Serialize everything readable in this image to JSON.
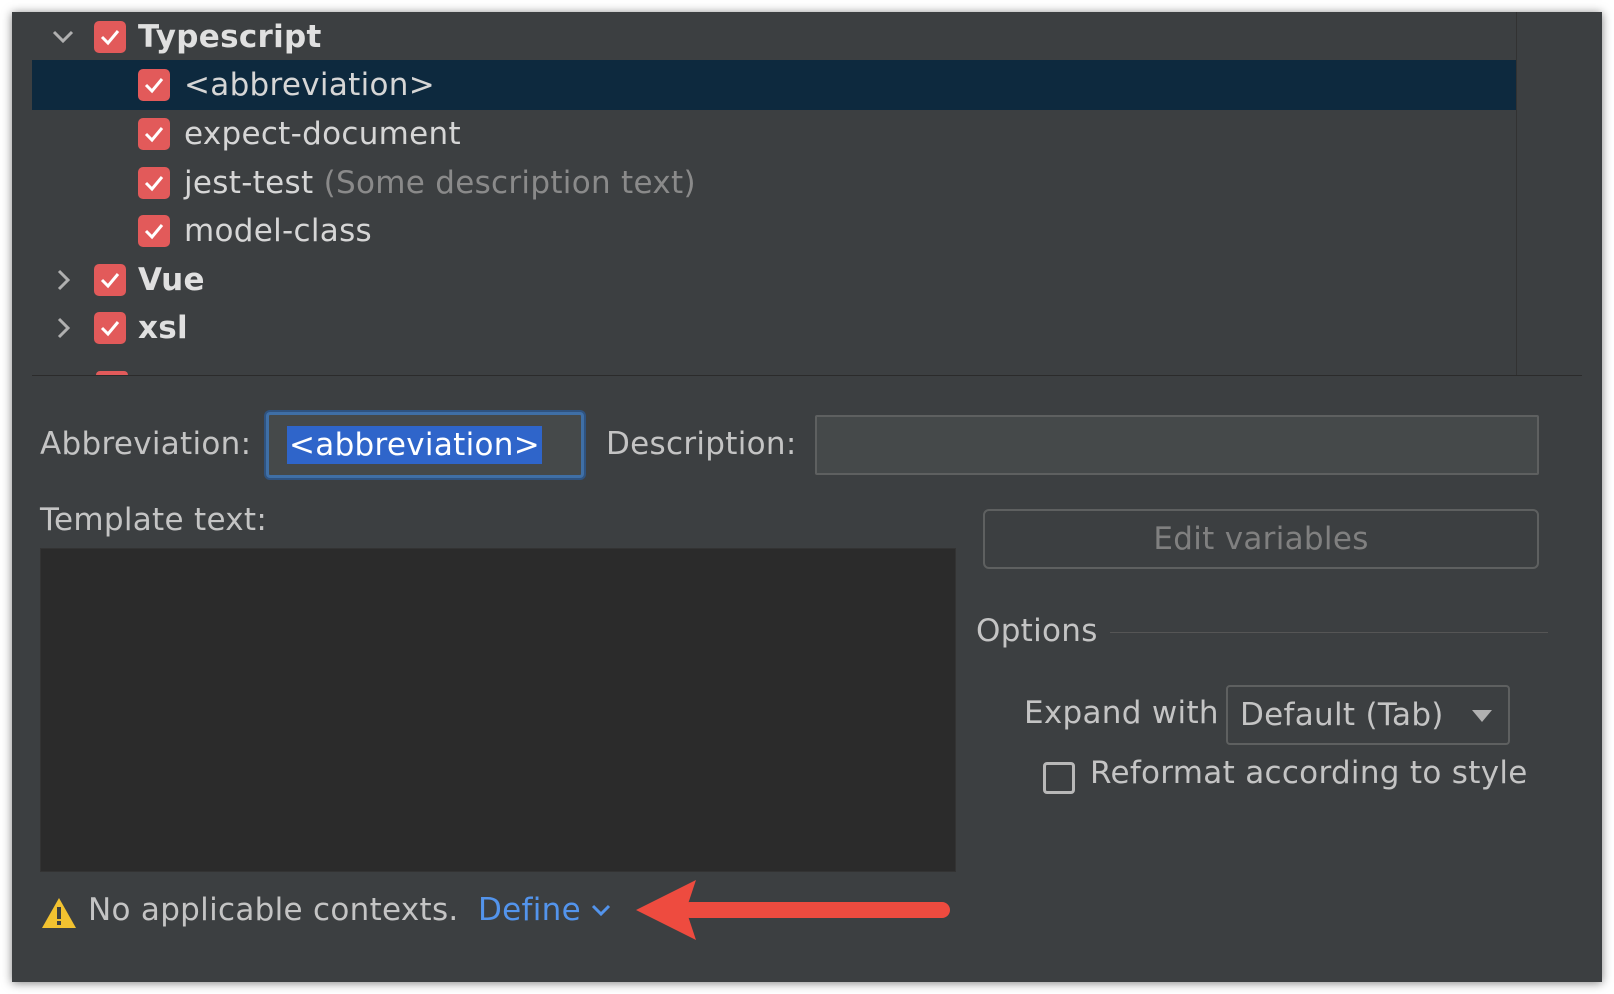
{
  "tree": {
    "groups": [
      {
        "label": "Typescript",
        "expanded": true,
        "checked": true
      },
      {
        "label": "Vue",
        "expanded": false,
        "checked": true
      },
      {
        "label": "xsl",
        "expanded": false,
        "checked": true
      }
    ],
    "items": [
      {
        "label": "<abbreviation>",
        "description": "",
        "checked": true,
        "selected": true
      },
      {
        "label": "expect-document",
        "description": "",
        "checked": true,
        "selected": false
      },
      {
        "label": "jest-test",
        "description": "(Some description text)",
        "checked": true,
        "selected": false
      },
      {
        "label": "model-class",
        "description": "",
        "checked": true,
        "selected": false
      }
    ]
  },
  "form": {
    "abbreviation_label": "Abbreviation:",
    "abbreviation_value": "<abbreviation>",
    "description_label": "Description:",
    "description_value": "",
    "template_label": "Template text:",
    "template_value": "",
    "edit_variables_label": "Edit variables",
    "options_label": "Options",
    "expand_with_label": "Expand with",
    "expand_with_value": "Default (Tab)",
    "reformat_label": "Reformat according to style",
    "reformat_checked": false
  },
  "footer": {
    "warning_text": "No applicable contexts.",
    "define_label": "Define"
  },
  "colors": {
    "background": "#3c3f41",
    "selected_row": "#0d293e",
    "checkbox": "#e25a5a",
    "link": "#5394ec",
    "warning": "#f2c230",
    "annotation_arrow": "#ee4b3f"
  },
  "icons": [
    "chevron-down-icon",
    "chevron-right-icon",
    "check-icon",
    "warning-icon",
    "dropdown-arrow-icon"
  ]
}
